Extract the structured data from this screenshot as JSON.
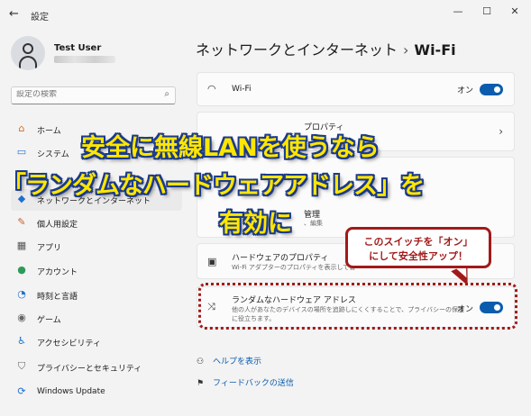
{
  "window": {
    "title": "設定",
    "back_icon": "←",
    "minimize": "—",
    "maximize": "☐",
    "close": "✕"
  },
  "user": {
    "name": "Test User"
  },
  "search": {
    "placeholder": "設定の検索"
  },
  "sidebar": {
    "items": [
      {
        "label": "ホーム",
        "icon": "home-icon"
      },
      {
        "label": "システム",
        "icon": "system-icon"
      },
      {
        "label": "ネットワークとインターネット",
        "icon": "network-icon"
      },
      {
        "label": "個人用設定",
        "icon": "brush-icon"
      },
      {
        "label": "アプリ",
        "icon": "apps-icon"
      },
      {
        "label": "アカウント",
        "icon": "account-icon"
      },
      {
        "label": "時刻と言語",
        "icon": "time-icon"
      },
      {
        "label": "ゲーム",
        "icon": "game-icon"
      },
      {
        "label": "アクセシビリティ",
        "icon": "accessibility-icon"
      },
      {
        "label": "プライバシーとセキュリティ",
        "icon": "shield-icon"
      },
      {
        "label": "Windows Update",
        "icon": "update-icon"
      }
    ]
  },
  "breadcrumb": {
    "parent": "ネットワークとインターネット",
    "separator": "›",
    "current": "Wi-Fi"
  },
  "cards": {
    "wifi": {
      "title": "Wi-Fi",
      "state": "オン"
    },
    "properties": {
      "title": "プロパティ"
    },
    "manage": {
      "title": "管理",
      "sub": "、編集"
    },
    "hardware": {
      "title": "ハードウェアのプロパティ",
      "sub": "Wi-Fi アダプターのプロパティを表示して管"
    },
    "random": {
      "title": "ランダムなハードウェア アドレス",
      "sub1": "他の人があなたのデバイスの場所を追跡しにくくすることで、プライバシーの保護",
      "sub2": "に役立ちます。",
      "state": "オン"
    }
  },
  "links": {
    "help": "ヘルプを表示",
    "feedback": "フィードバックの送信"
  },
  "annotation": {
    "headline1": "安全に無線LANを使うなら",
    "headline2": "「ランダムなハードウェアアドレス」を",
    "headline3": "有効に",
    "callout1": "このスイッチを「オン」",
    "callout2": "にして安全性アップ！"
  },
  "colors": {
    "accent": "#0b5cad",
    "annotation_red": "#a11a1a",
    "headline_yellow": "#ffe600",
    "headline_outline": "#1b3a8a"
  }
}
